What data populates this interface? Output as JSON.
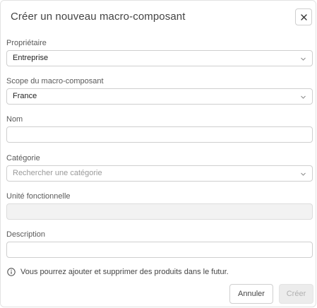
{
  "dialog": {
    "title": "Créer un nouveau macro-composant",
    "close_icon": "close-icon"
  },
  "fields": {
    "owner": {
      "label": "Propriétaire",
      "value": "Entreprise",
      "icon": "chevron-down-icon"
    },
    "scope": {
      "label": "Scope du macro-composant",
      "value": "France",
      "icon": "chevron-down-icon"
    },
    "name": {
      "label": "Nom",
      "value": ""
    },
    "category": {
      "label": "Catégorie",
      "placeholder": "Rechercher une catégorie",
      "icon": "chevron-down-icon"
    },
    "functional_unit": {
      "label": "Unité fonctionnelle",
      "value": "",
      "disabled": true
    },
    "description": {
      "label": "Description",
      "value": ""
    }
  },
  "info": {
    "icon": "info-icon",
    "text": "Vous pourrez ajouter et supprimer des produits dans le futur."
  },
  "actions": {
    "cancel_label": "Annuler",
    "create_label": "Créer",
    "create_disabled": true
  },
  "colors": {
    "text": "#444444",
    "border": "#cfcfcf",
    "disabled_bg": "#f2f2f2",
    "disabled_button_text": "#b0b0b0"
  }
}
